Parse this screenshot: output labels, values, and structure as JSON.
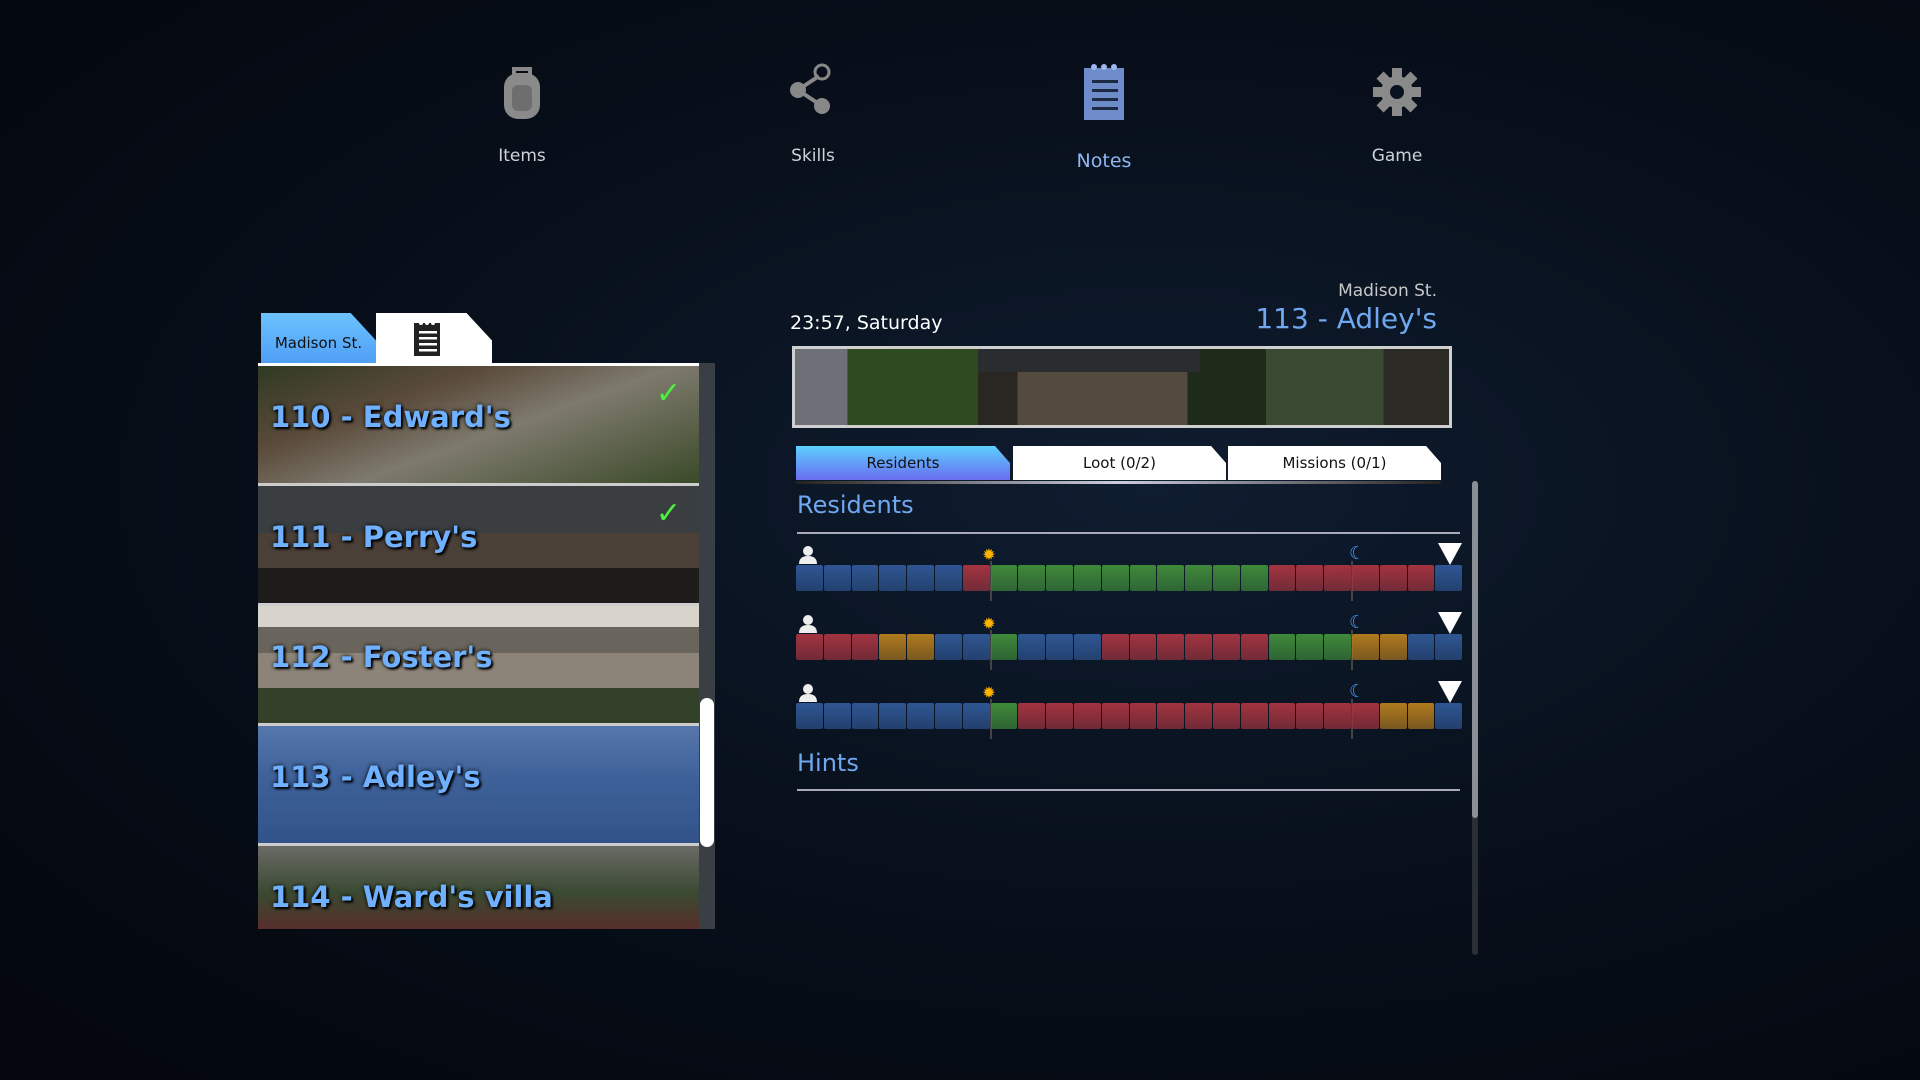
{
  "nav": [
    {
      "label": "Items",
      "icon": "backpack-icon"
    },
    {
      "label": "Skills",
      "icon": "share-nodes-icon"
    },
    {
      "label": "Notes",
      "icon": "notepad-icon",
      "active": true
    },
    {
      "label": "Game",
      "icon": "gear-icon"
    }
  ],
  "left": {
    "tab_street": "Madison St.",
    "tab_notes_icon": "notepad-icon",
    "houses": [
      {
        "label": "110 - Edward's",
        "done": true
      },
      {
        "label": "111 - Perry's",
        "done": true
      },
      {
        "label": "112 - Foster's",
        "done": false
      },
      {
        "label": "113 - Adley's",
        "done": false,
        "selected": true
      },
      {
        "label": "114 - Ward's villa",
        "done": false
      }
    ]
  },
  "detail": {
    "time": "23:57, Saturday",
    "street": "Madison St.",
    "house": "113 - Adley's",
    "tabs": [
      {
        "label": "Residents",
        "active": true
      },
      {
        "label": "Loot (0/2)"
      },
      {
        "label": "Missions (0/1)"
      }
    ],
    "residents_heading": "Residents",
    "hints_heading": "Hints",
    "sunrise_hour": 7,
    "sunset_hour": 20,
    "colors": {
      "B": "#2f5693",
      "R": "#a33440",
      "G": "#3f8a3a",
      "O": "#b07a1e"
    },
    "schedules": [
      "BBBBBBRGGGGGGGGGGRRRRRRB",
      "RRROOBBGBBBRRRRRRGGGOOBB",
      "BBBBBBBGRRRRRRRRRRRRROOBB"
    ]
  }
}
